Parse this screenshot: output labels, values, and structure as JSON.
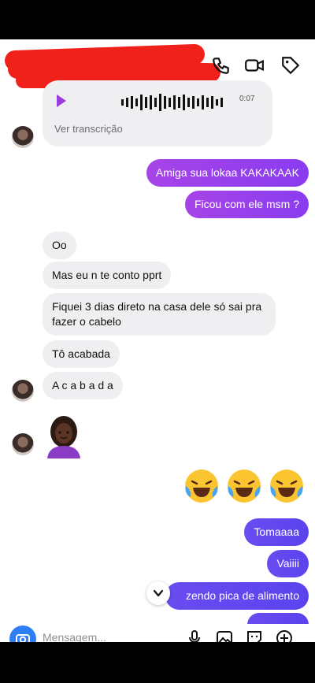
{
  "audio": {
    "duration": "0:07",
    "transcript_label": "Ver transcrição"
  },
  "messages": {
    "out_1": "Amiga sua lokaa KAKAKAAK",
    "out_2": "Ficou com ele msm ?",
    "in_1": "Oo",
    "in_2": "Mas eu n te conto pprt",
    "in_3": "Fiquei 3 dias direto na casa dele só sai pra fazer o cabelo",
    "in_4": "Tô acabada",
    "in_5": "A c a b a d a",
    "out_3": "Tomaaaa",
    "out_4": "Vaiiii",
    "out_5": "zendo pica de alimento"
  },
  "composer": {
    "placeholder": "Mensagem..."
  },
  "colors": {
    "accent_purple": "#9b3ae0",
    "redaction": "#f0201a",
    "camera_blue": "#2e7ef7"
  },
  "icons": [
    "call-icon",
    "video-icon",
    "tag-icon",
    "play-icon",
    "chevron-down-icon",
    "camera-icon",
    "mic-icon",
    "gallery-icon",
    "sticker-icon",
    "plus-icon"
  ]
}
